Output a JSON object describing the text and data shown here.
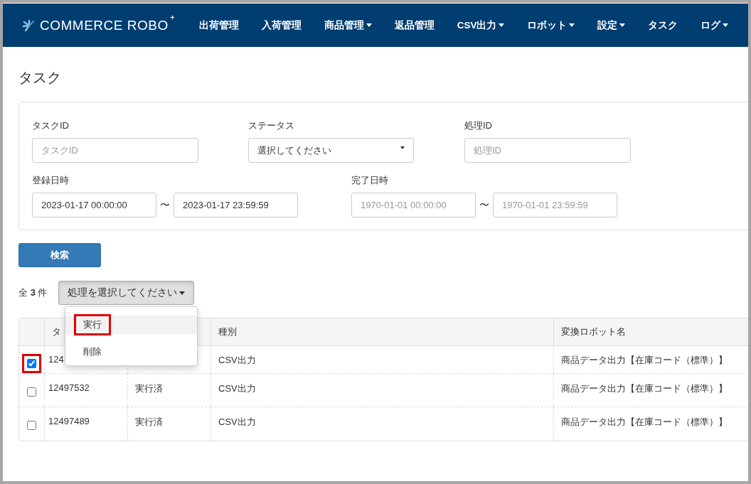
{
  "nav": {
    "logo": "COMMERCE ROBO",
    "items": [
      {
        "label": "出荷管理",
        "caret": false
      },
      {
        "label": "入荷管理",
        "caret": false
      },
      {
        "label": "商品管理",
        "caret": true
      },
      {
        "label": "返品管理",
        "caret": false
      },
      {
        "label": "CSV出力",
        "caret": true
      },
      {
        "label": "ロボット",
        "caret": true
      },
      {
        "label": "設定",
        "caret": true
      },
      {
        "label": "タスク",
        "caret": false
      },
      {
        "label": "ログ",
        "caret": true
      }
    ]
  },
  "page_title": "タスク",
  "filters": {
    "fields": [
      {
        "kind": "text",
        "label": "タスクID",
        "placeholder": "タスクID"
      },
      {
        "kind": "select",
        "label": "ステータス",
        "value": "選択してください"
      },
      {
        "kind": "text",
        "label": "処理ID",
        "placeholder": "処理ID"
      },
      {
        "kind": "range",
        "label": "登録日時",
        "separator": "〜",
        "from": {
          "value": "2023-01-17 00:00:00"
        },
        "to": {
          "value": "2023-01-17 23:59:59"
        }
      },
      {
        "kind": "range",
        "label": "完了日時",
        "separator": "〜",
        "from": {
          "placeholder": "1970-01-01 00:00:00"
        },
        "to": {
          "placeholder": "1970-01-01 23:59:59"
        }
      }
    ]
  },
  "search_button": "検索",
  "count": {
    "prefix": "全",
    "number": "3",
    "suffix": "件"
  },
  "action_dropdown": {
    "label": "処理を選択してください",
    "expanded": true,
    "items": [
      {
        "label": "実行",
        "hovered": true,
        "highlighted": true
      },
      {
        "label": "削除",
        "hovered": false,
        "highlighted": false
      }
    ]
  },
  "table": {
    "columns": [
      "タ",
      "",
      "種別",
      "変換ロボット名"
    ],
    "rows": [
      {
        "checked": true,
        "highlighted": true,
        "cells": [
          "124",
          "",
          "CSV出力",
          "商品データ出力【在庫コード（標準）】"
        ]
      },
      {
        "checked": false,
        "highlighted": false,
        "cells": [
          "12497532",
          "実行済",
          "CSV出力",
          "商品データ出力【在庫コード（標準）】"
        ]
      },
      {
        "checked": false,
        "highlighted": false,
        "cells": [
          "12497489",
          "実行済",
          "CSV出力",
          "商品データ出力【在庫コード（標準）】"
        ]
      }
    ]
  }
}
